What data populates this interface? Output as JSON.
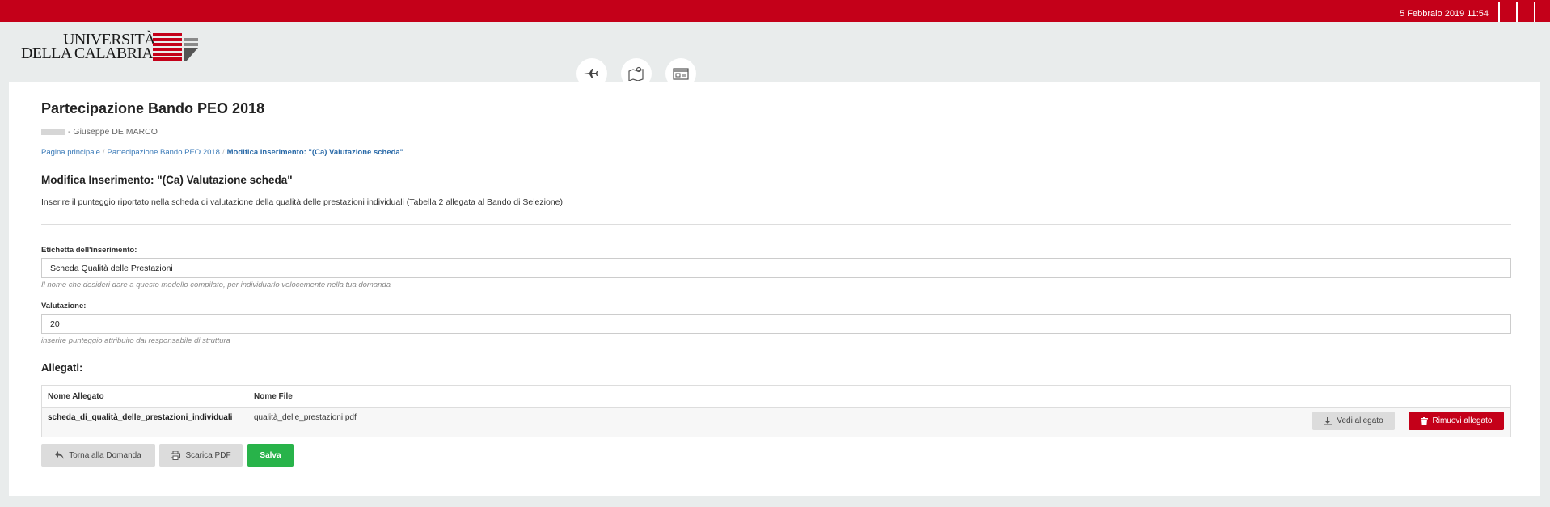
{
  "header": {
    "date": "5 Febbraio 2019 11:54",
    "brand_color": "#c40019",
    "logo": {
      "line1": "UNIVERSITÀ",
      "line2": "DELLA CALABRIA"
    },
    "nav_icons": [
      "airplane-icon",
      "map-icon",
      "id-card-icon"
    ]
  },
  "page": {
    "title": "Partecipazione Bando PEO 2018",
    "user": "- Giuseppe DE MARCO",
    "breadcrumb": [
      "Pagina principale",
      "Partecipazione Bando PEO 2018",
      "Modifica Inserimento: \"(Ca) Valutazione scheda\""
    ]
  },
  "form": {
    "title": "Modifica Inserimento: \"(Ca) Valutazione scheda\"",
    "description": "Inserire il punteggio riportato nella scheda di valutazione della qualità delle prestazioni individuali (Tabella 2 allegata al Bando di Selezione)",
    "label_field": {
      "label": "Etichetta dell'inserimento:",
      "value": "Scheda Qualità delle Prestazioni",
      "help": "Il nome che desideri dare a questo modello compilato, per individuarlo velocemente nella tua domanda"
    },
    "valutazione_field": {
      "label": "Valutazione:",
      "value": "20",
      "help": "inserire punteggio attribuito dal responsabile di struttura"
    }
  },
  "attachments": {
    "title": "Allegati:",
    "columns": [
      "Nome Allegato",
      "Nome File"
    ],
    "rows": [
      {
        "name": "scheda_di_qualità_delle_prestazioni_individuali",
        "file": "qualità_delle_prestazioni.pdf",
        "view_label": "Vedi allegato",
        "remove_label": "Rimuovi allegato"
      }
    ]
  },
  "actions": {
    "back_label": "Torna alla Domanda",
    "pdf_label": "Scarica PDF",
    "save_label": "Salva"
  },
  "colors": {
    "accent_red": "#c40019",
    "save_green": "#28b34a",
    "link_blue": "#3a7ab8"
  }
}
